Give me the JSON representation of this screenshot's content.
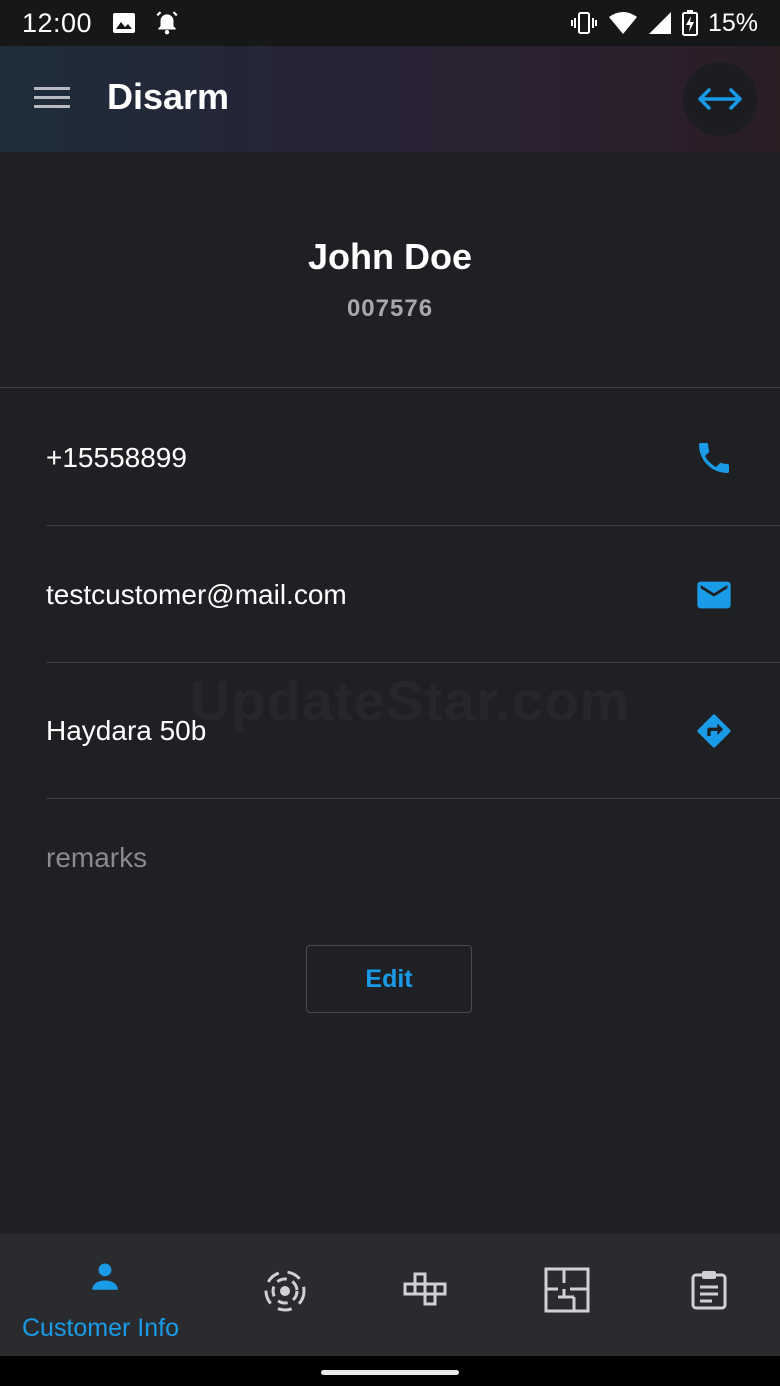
{
  "status_bar": {
    "time": "12:00",
    "left_icons": [
      "image-icon",
      "alarm-icon"
    ],
    "right_icons": [
      "vibrate-icon",
      "wifi-icon",
      "signal-icon",
      "battery-charging-icon"
    ],
    "battery": "15%"
  },
  "app_bar": {
    "title": "Disarm",
    "menu_icon": "hamburger-menu-icon",
    "action_icon": "swap-horizontal-icon"
  },
  "customer": {
    "name": "John Doe",
    "id": "007576"
  },
  "contact": {
    "phone": "+15558899",
    "email": "testcustomer@mail.com",
    "address": "Haydara 50b",
    "remarks_placeholder": "remarks"
  },
  "watermark": "UpdateStar.com",
  "edit_label": "Edit",
  "bottom_nav": {
    "items": [
      {
        "label": "Customer Info",
        "icon": "person-icon",
        "active": true
      },
      {
        "label": "",
        "icon": "sensor-icon",
        "active": false
      },
      {
        "label": "",
        "icon": "zones-icon",
        "active": false
      },
      {
        "label": "",
        "icon": "floor-plan-icon",
        "active": false
      },
      {
        "label": "",
        "icon": "clipboard-icon",
        "active": false
      }
    ]
  },
  "colors": {
    "accent": "#1a9be8",
    "background": "#1f2024",
    "nav_background": "#2a2b2f"
  }
}
